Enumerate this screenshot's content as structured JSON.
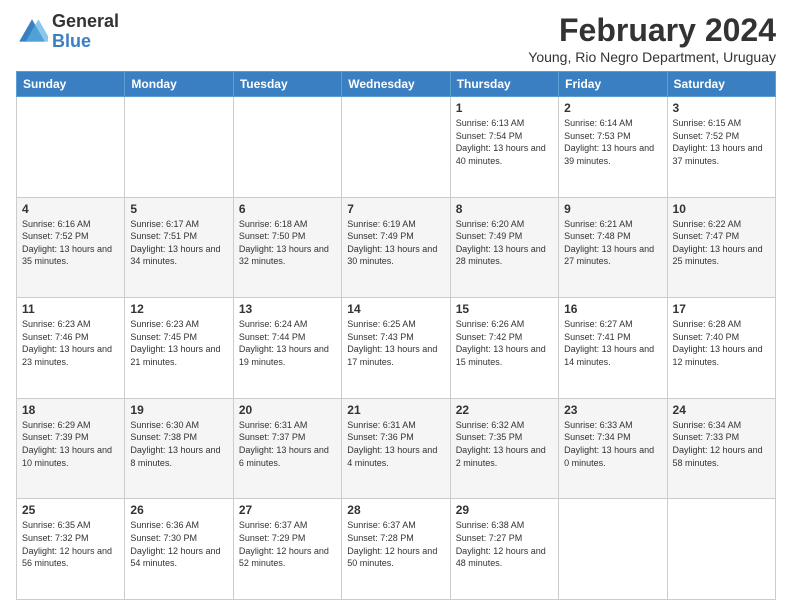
{
  "header": {
    "logo_general": "General",
    "logo_blue": "Blue",
    "month_year": "February 2024",
    "subtitle": "Young, Rio Negro Department, Uruguay"
  },
  "days_of_week": [
    "Sunday",
    "Monday",
    "Tuesday",
    "Wednesday",
    "Thursday",
    "Friday",
    "Saturday"
  ],
  "weeks": [
    [
      {
        "day": "",
        "info": ""
      },
      {
        "day": "",
        "info": ""
      },
      {
        "day": "",
        "info": ""
      },
      {
        "day": "",
        "info": ""
      },
      {
        "day": "1",
        "info": "Sunrise: 6:13 AM\nSunset: 7:54 PM\nDaylight: 13 hours and 40 minutes."
      },
      {
        "day": "2",
        "info": "Sunrise: 6:14 AM\nSunset: 7:53 PM\nDaylight: 13 hours and 39 minutes."
      },
      {
        "day": "3",
        "info": "Sunrise: 6:15 AM\nSunset: 7:52 PM\nDaylight: 13 hours and 37 minutes."
      }
    ],
    [
      {
        "day": "4",
        "info": "Sunrise: 6:16 AM\nSunset: 7:52 PM\nDaylight: 13 hours and 35 minutes."
      },
      {
        "day": "5",
        "info": "Sunrise: 6:17 AM\nSunset: 7:51 PM\nDaylight: 13 hours and 34 minutes."
      },
      {
        "day": "6",
        "info": "Sunrise: 6:18 AM\nSunset: 7:50 PM\nDaylight: 13 hours and 32 minutes."
      },
      {
        "day": "7",
        "info": "Sunrise: 6:19 AM\nSunset: 7:49 PM\nDaylight: 13 hours and 30 minutes."
      },
      {
        "day": "8",
        "info": "Sunrise: 6:20 AM\nSunset: 7:49 PM\nDaylight: 13 hours and 28 minutes."
      },
      {
        "day": "9",
        "info": "Sunrise: 6:21 AM\nSunset: 7:48 PM\nDaylight: 13 hours and 27 minutes."
      },
      {
        "day": "10",
        "info": "Sunrise: 6:22 AM\nSunset: 7:47 PM\nDaylight: 13 hours and 25 minutes."
      }
    ],
    [
      {
        "day": "11",
        "info": "Sunrise: 6:23 AM\nSunset: 7:46 PM\nDaylight: 13 hours and 23 minutes."
      },
      {
        "day": "12",
        "info": "Sunrise: 6:23 AM\nSunset: 7:45 PM\nDaylight: 13 hours and 21 minutes."
      },
      {
        "day": "13",
        "info": "Sunrise: 6:24 AM\nSunset: 7:44 PM\nDaylight: 13 hours and 19 minutes."
      },
      {
        "day": "14",
        "info": "Sunrise: 6:25 AM\nSunset: 7:43 PM\nDaylight: 13 hours and 17 minutes."
      },
      {
        "day": "15",
        "info": "Sunrise: 6:26 AM\nSunset: 7:42 PM\nDaylight: 13 hours and 15 minutes."
      },
      {
        "day": "16",
        "info": "Sunrise: 6:27 AM\nSunset: 7:41 PM\nDaylight: 13 hours and 14 minutes."
      },
      {
        "day": "17",
        "info": "Sunrise: 6:28 AM\nSunset: 7:40 PM\nDaylight: 13 hours and 12 minutes."
      }
    ],
    [
      {
        "day": "18",
        "info": "Sunrise: 6:29 AM\nSunset: 7:39 PM\nDaylight: 13 hours and 10 minutes."
      },
      {
        "day": "19",
        "info": "Sunrise: 6:30 AM\nSunset: 7:38 PM\nDaylight: 13 hours and 8 minutes."
      },
      {
        "day": "20",
        "info": "Sunrise: 6:31 AM\nSunset: 7:37 PM\nDaylight: 13 hours and 6 minutes."
      },
      {
        "day": "21",
        "info": "Sunrise: 6:31 AM\nSunset: 7:36 PM\nDaylight: 13 hours and 4 minutes."
      },
      {
        "day": "22",
        "info": "Sunrise: 6:32 AM\nSunset: 7:35 PM\nDaylight: 13 hours and 2 minutes."
      },
      {
        "day": "23",
        "info": "Sunrise: 6:33 AM\nSunset: 7:34 PM\nDaylight: 13 hours and 0 minutes."
      },
      {
        "day": "24",
        "info": "Sunrise: 6:34 AM\nSunset: 7:33 PM\nDaylight: 12 hours and 58 minutes."
      }
    ],
    [
      {
        "day": "25",
        "info": "Sunrise: 6:35 AM\nSunset: 7:32 PM\nDaylight: 12 hours and 56 minutes."
      },
      {
        "day": "26",
        "info": "Sunrise: 6:36 AM\nSunset: 7:30 PM\nDaylight: 12 hours and 54 minutes."
      },
      {
        "day": "27",
        "info": "Sunrise: 6:37 AM\nSunset: 7:29 PM\nDaylight: 12 hours and 52 minutes."
      },
      {
        "day": "28",
        "info": "Sunrise: 6:37 AM\nSunset: 7:28 PM\nDaylight: 12 hours and 50 minutes."
      },
      {
        "day": "29",
        "info": "Sunrise: 6:38 AM\nSunset: 7:27 PM\nDaylight: 12 hours and 48 minutes."
      },
      {
        "day": "",
        "info": ""
      },
      {
        "day": "",
        "info": ""
      }
    ]
  ]
}
